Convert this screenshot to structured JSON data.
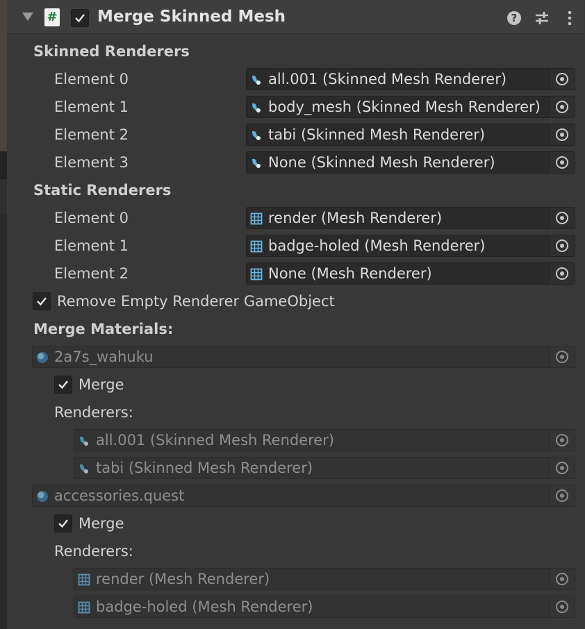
{
  "header": {
    "title": "Merge Skinned Mesh",
    "script_icon_glyph": "#",
    "enabled": true
  },
  "skinned": {
    "label": "Skinned Renderers",
    "elements": [
      {
        "label": "Element 0",
        "value": "all.001 (Skinned Mesh Renderer)"
      },
      {
        "label": "Element 1",
        "value": "body_mesh (Skinned Mesh Renderer)"
      },
      {
        "label": "Element 2",
        "value": "tabi (Skinned Mesh Renderer)"
      },
      {
        "label": "Element 3",
        "value": "None (Skinned Mesh Renderer)"
      }
    ]
  },
  "static": {
    "label": "Static Renderers",
    "elements": [
      {
        "label": "Element 0",
        "value": "render (Mesh Renderer)"
      },
      {
        "label": "Element 1",
        "value": "badge-holed (Mesh Renderer)"
      },
      {
        "label": "Element 2",
        "value": "None (Mesh Renderer)"
      }
    ]
  },
  "remove_empty": {
    "label": "Remove Empty Renderer GameObject",
    "checked": true
  },
  "merge_materials": {
    "label": "Merge Materials:",
    "groups": [
      {
        "material": "2a7s_wahuku",
        "merge_label": "Merge",
        "merge_checked": true,
        "renderers_label": "Renderers:",
        "renderers": [
          "all.001 (Skinned Mesh Renderer)",
          "tabi (Skinned Mesh Renderer)"
        ]
      },
      {
        "material": "accessories.quest",
        "merge_label": "Merge",
        "merge_checked": true,
        "renderers_label": "Renderers:",
        "renderers": [
          "render (Mesh Renderer)",
          "badge-holed (Mesh Renderer)"
        ]
      }
    ]
  },
  "icons": {
    "skinned_mesh": "skinned-mesh-renderer-icon",
    "mesh": "mesh-renderer-icon",
    "material": "material-icon",
    "picker": "object-picker-icon"
  },
  "colors": {
    "background": "#383838",
    "field": "#2a2a2a",
    "accent_icon": "#5ab0dc"
  }
}
